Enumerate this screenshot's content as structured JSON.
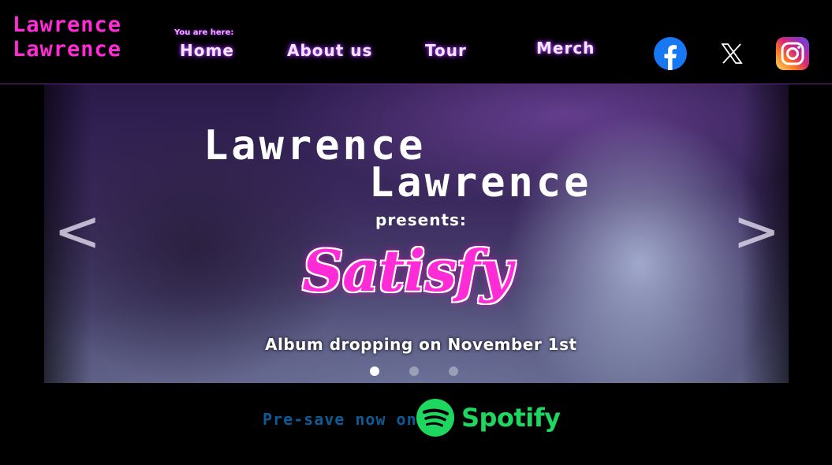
{
  "brand": {
    "line1": "Lawrence",
    "line2": "Lawrence"
  },
  "nav": {
    "you_are_here": "You are here:",
    "items": [
      {
        "label": "Home",
        "active": true
      },
      {
        "label": "About us"
      },
      {
        "label": "Tour"
      },
      {
        "label": "Merch"
      }
    ]
  },
  "social": [
    {
      "icon": "facebook-icon",
      "color": "#1877f2"
    },
    {
      "icon": "x-icon",
      "color": "#ffffff"
    },
    {
      "icon": "instagram-icon",
      "color": "#e1306c"
    }
  ],
  "hero": {
    "title_line1": "Lawrence",
    "title_line2": "Lawrence",
    "presents": "presents:",
    "album": "Satisfy",
    "release": "Album dropping on November 1st",
    "slides": 3,
    "active_slide": 1,
    "prev_icon": "chevron-left-icon",
    "next_icon": "chevron-right-icon"
  },
  "cta": {
    "text": "Pre-save now on",
    "service": "Spotify"
  },
  "colors": {
    "accent": "#ff2bd6",
    "cta": "#0d5a96",
    "spotify": "#1ed760"
  }
}
